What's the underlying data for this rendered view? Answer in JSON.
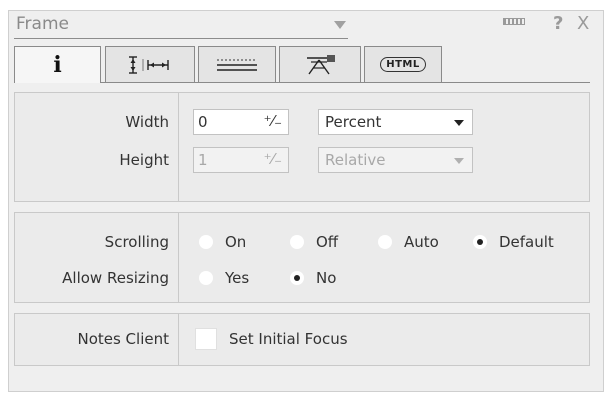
{
  "header": {
    "title": "Frame",
    "icons": [
      "dash-icon",
      "help-icon",
      "close-icon"
    ],
    "help_glyph": "?",
    "close_glyph": "X"
  },
  "tabs": [
    {
      "icon": "info-icon",
      "glyph": "i",
      "active": true
    },
    {
      "icon": "dimensions-icon",
      "active": false
    },
    {
      "icon": "borders-icon",
      "active": false
    },
    {
      "icon": "paragraph-icon",
      "active": false
    },
    {
      "icon": "html-icon",
      "glyph": "HTML",
      "active": false
    }
  ],
  "size": {
    "width_label": "Width",
    "width_value": "0",
    "width_unit": "Percent",
    "height_label": "Height",
    "height_value": "1",
    "height_unit": "Relative"
  },
  "scrolling": {
    "label": "Scrolling",
    "options": [
      "On",
      "Off",
      "Auto",
      "Default"
    ],
    "selected": "Default"
  },
  "resizing": {
    "label": "Allow Resizing",
    "options": [
      "Yes",
      "No"
    ],
    "selected": "No"
  },
  "notes": {
    "label": "Notes Client",
    "checkbox_label": "Set Initial Focus",
    "checked": false
  },
  "colors": {
    "panel_bg": "#efefef",
    "section_bg": "#ebebeb",
    "disabled_text": "#a8a8a8"
  }
}
